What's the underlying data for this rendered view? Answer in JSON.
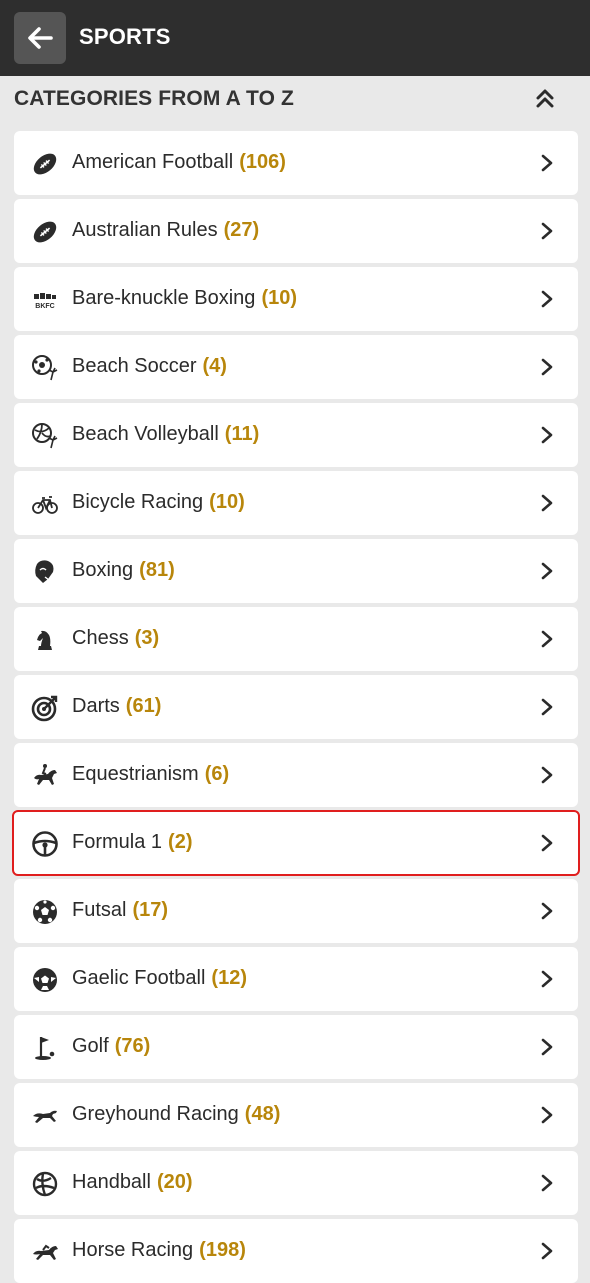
{
  "header": {
    "title": "SPORTS",
    "back_icon": "arrow-left-icon"
  },
  "section": {
    "title": "CATEGORIES FROM A TO Z",
    "collapse_icon": "double-chevron-up-icon"
  },
  "colors": {
    "count": "#b8860b",
    "selected_border": "#e01e1e",
    "header_bg": "#2e2e2e"
  },
  "categories": [
    {
      "label": "American Football",
      "count": "(106)",
      "icon": "american-football-icon"
    },
    {
      "label": "Australian Rules",
      "count": "(27)",
      "icon": "aussie-rules-ball-icon"
    },
    {
      "label": "Bare-knuckle Boxing",
      "count": "(10)",
      "icon": "bkfc-logo-icon"
    },
    {
      "label": "Beach Soccer",
      "count": "(4)",
      "icon": "beach-soccer-icon"
    },
    {
      "label": "Beach Volleyball",
      "count": "(11)",
      "icon": "beach-volleyball-icon"
    },
    {
      "label": "Bicycle Racing",
      "count": "(10)",
      "icon": "bicycle-icon"
    },
    {
      "label": "Boxing",
      "count": "(81)",
      "icon": "boxing-glove-icon"
    },
    {
      "label": "Chess",
      "count": "(3)",
      "icon": "chess-knight-icon"
    },
    {
      "label": "Darts",
      "count": "(61)",
      "icon": "dartboard-icon"
    },
    {
      "label": "Equestrianism",
      "count": "(6)",
      "icon": "equestrian-icon"
    },
    {
      "label": "Formula 1",
      "count": "(2)",
      "icon": "steering-wheel-icon",
      "selected": true
    },
    {
      "label": "Futsal",
      "count": "(17)",
      "icon": "futsal-ball-icon"
    },
    {
      "label": "Gaelic Football",
      "count": "(12)",
      "icon": "gaelic-ball-icon"
    },
    {
      "label": "Golf",
      "count": "(76)",
      "icon": "golf-flag-icon"
    },
    {
      "label": "Greyhound Racing",
      "count": "(48)",
      "icon": "greyhound-icon"
    },
    {
      "label": "Handball",
      "count": "(20)",
      "icon": "handball-icon"
    },
    {
      "label": "Horse Racing",
      "count": "(198)",
      "icon": "horse-racing-icon"
    }
  ]
}
